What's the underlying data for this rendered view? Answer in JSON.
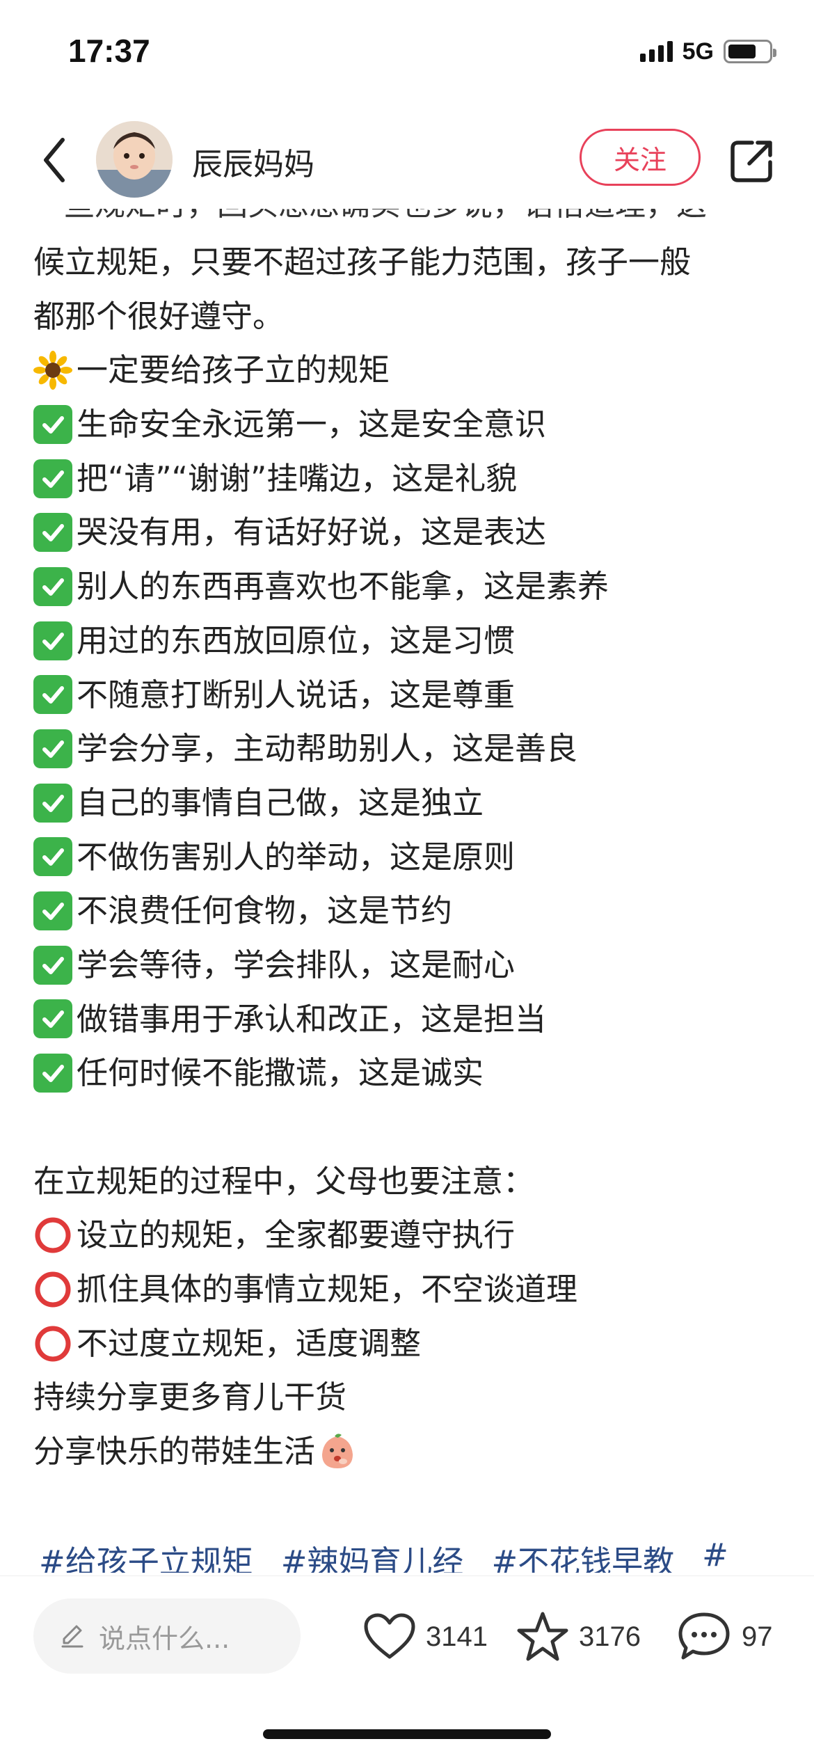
{
  "status_bar": {
    "time": "17:37",
    "network": "5G"
  },
  "header": {
    "author_name": "辰辰妈妈",
    "follow_label": "关注"
  },
  "content": {
    "partial_top_line": "一些规矩时，回头想想确实也多说，语悟道理，这",
    "intro": [
      "候立规矩，只要不超过孩子能力范围，孩子一般",
      "都那个很好遵守。"
    ],
    "section_title": "一定要给孩子立的规矩",
    "rules": [
      "生命安全永远第一，这是安全意识",
      "把“请”“谢谢”挂嘴边，这是礼貌",
      "哭没有用，有话好好说，这是表达",
      "别人的东西再喜欢也不能拿，这是素养",
      "用过的东西放回原位，这是习惯",
      "不随意打断别人说话，这是尊重",
      "学会分享，主动帮助别人，这是善良",
      "自己的事情自己做，这是独立",
      "不做伤害别人的举动，这是原则",
      "不浪费任何食物，这是节约",
      "学会等待，学会排队，这是耐心",
      "做错事用于承认和改正，这是担当",
      "任何时候不能撒谎，这是诚实"
    ],
    "notes_title": "在立规矩的过程中，父母也要注意：",
    "notes": [
      "设立的规矩，全家都要遵守执行",
      "抓住具体的事情立规矩，不空谈道理",
      "不过度立规矩，适度调整"
    ],
    "outro": [
      "持续分享更多育儿干货",
      "分享快乐的带娃生活"
    ],
    "tags": [
      "#给孩子立规矩",
      "#辣妈育儿经",
      "#不花钱早教",
      "#"
    ]
  },
  "bottom_bar": {
    "comment_placeholder": "说点什么...",
    "likes": "3141",
    "favorites": "3176",
    "comments": "97"
  },
  "colors": {
    "accent": "#e8415a",
    "tag": "#2b4b86",
    "check": "#3cb34a",
    "circle": "#e03a3a"
  },
  "icons": [
    "back-icon",
    "share-icon",
    "sunflower-icon",
    "check-icon",
    "circle-icon",
    "emoji-face-icon",
    "pencil-icon",
    "heart-icon",
    "star-icon",
    "comment-icon",
    "signal-icon",
    "battery-icon"
  ]
}
